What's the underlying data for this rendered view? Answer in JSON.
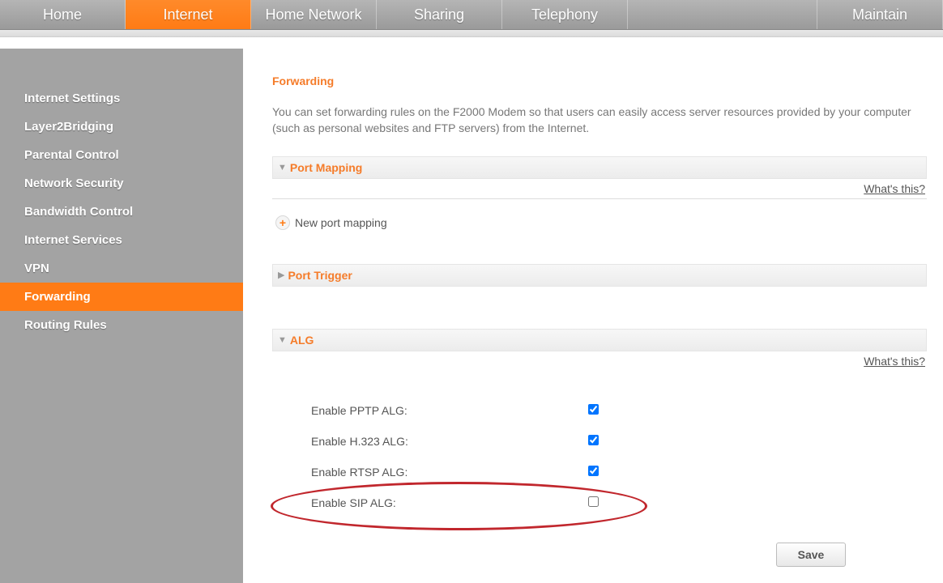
{
  "topnav": {
    "items": [
      {
        "label": "Home"
      },
      {
        "label": "Internet"
      },
      {
        "label": "Home Network"
      },
      {
        "label": "Sharing"
      },
      {
        "label": "Telephony"
      },
      {
        "label": "Maintain"
      }
    ]
  },
  "sidebar": {
    "items": [
      {
        "label": "Internet Settings"
      },
      {
        "label": "Layer2Bridging"
      },
      {
        "label": "Parental Control"
      },
      {
        "label": "Network Security"
      },
      {
        "label": "Bandwidth Control"
      },
      {
        "label": "Internet Services"
      },
      {
        "label": "VPN"
      },
      {
        "label": "Forwarding"
      },
      {
        "label": "Routing Rules"
      }
    ]
  },
  "main": {
    "title": "Forwarding",
    "description": "You can set forwarding rules on the F2000 Modem so that users can easily access server resources provided by your computer (such as personal websites and FTP servers) from the Internet.",
    "whats_this": "What's this?",
    "port_mapping": {
      "title": "Port Mapping",
      "new_label": "New port mapping"
    },
    "port_trigger": {
      "title": "Port Trigger"
    },
    "alg": {
      "title": "ALG",
      "options": [
        {
          "label": "Enable PPTP ALG:",
          "checked": true
        },
        {
          "label": "Enable H.323 ALG:",
          "checked": true
        },
        {
          "label": "Enable RTSP ALG:",
          "checked": true
        },
        {
          "label": "Enable SIP ALG:",
          "checked": false
        }
      ]
    },
    "save_label": "Save"
  }
}
